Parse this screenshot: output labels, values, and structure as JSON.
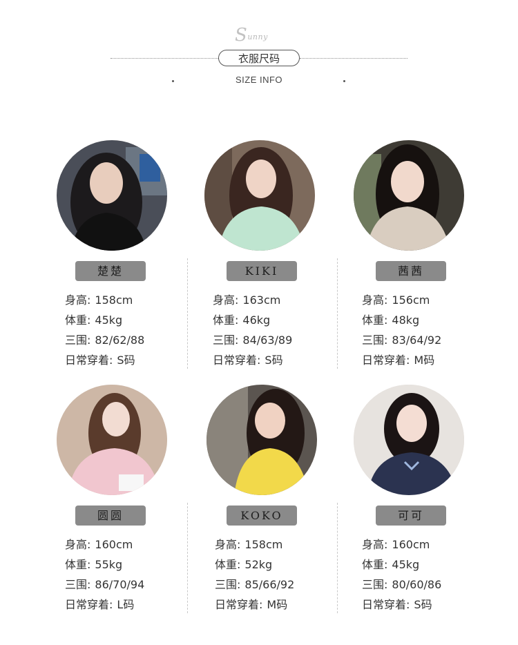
{
  "header": {
    "brand_initial": "S",
    "brand_rest": "unny",
    "title": "衣服尺码",
    "subtitle": "SIZE INFO"
  },
  "labels": {
    "height": "身高:",
    "weight": "体重:",
    "measurements": "三围:",
    "daily_size": "日常穿着:"
  },
  "models": [
    {
      "name": "楚楚",
      "height": "158cm",
      "weight": "45kg",
      "measurements": "82/62/88",
      "daily_size": "S码"
    },
    {
      "name": "KIKI",
      "height": "163cm",
      "weight": "46kg",
      "measurements": "84/63/89",
      "daily_size": "S码"
    },
    {
      "name": "茜茜",
      "height": "156cm",
      "weight": "48kg",
      "measurements": "83/64/92",
      "daily_size": "M码"
    },
    {
      "name": "圆圆",
      "height": "160cm",
      "weight": "55kg",
      "measurements": "86/70/94",
      "daily_size": "L码"
    },
    {
      "name": "KOKO",
      "height": "158cm",
      "weight": "52kg",
      "measurements": "85/66/92",
      "daily_size": "M码"
    },
    {
      "name": "可可",
      "height": "160cm",
      "weight": "45kg",
      "measurements": "80/60/86",
      "daily_size": "S码"
    }
  ],
  "colors": {
    "tag_bg": "#8a8a8a",
    "text": "#333333",
    "separator": "#c7c7c7"
  }
}
